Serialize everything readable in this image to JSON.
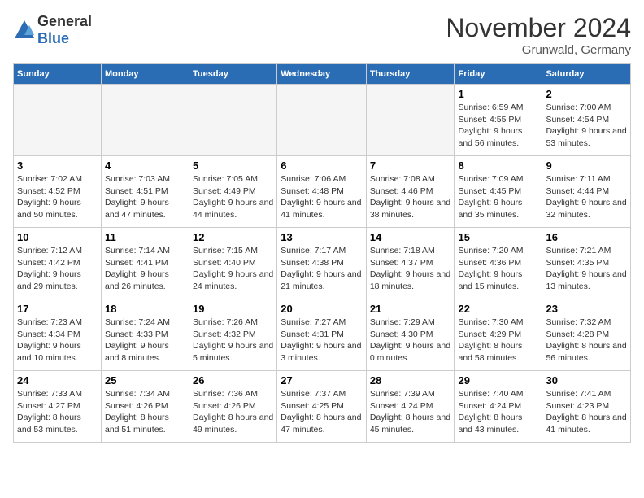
{
  "header": {
    "logo_general": "General",
    "logo_blue": "Blue",
    "month_title": "November 2024",
    "location": "Grunwald, Germany"
  },
  "days_of_week": [
    "Sunday",
    "Monday",
    "Tuesday",
    "Wednesday",
    "Thursday",
    "Friday",
    "Saturday"
  ],
  "weeks": [
    [
      {
        "day": "",
        "info": ""
      },
      {
        "day": "",
        "info": ""
      },
      {
        "day": "",
        "info": ""
      },
      {
        "day": "",
        "info": ""
      },
      {
        "day": "",
        "info": ""
      },
      {
        "day": "1",
        "info": "Sunrise: 6:59 AM\nSunset: 4:55 PM\nDaylight: 9 hours and 56 minutes."
      },
      {
        "day": "2",
        "info": "Sunrise: 7:00 AM\nSunset: 4:54 PM\nDaylight: 9 hours and 53 minutes."
      }
    ],
    [
      {
        "day": "3",
        "info": "Sunrise: 7:02 AM\nSunset: 4:52 PM\nDaylight: 9 hours and 50 minutes."
      },
      {
        "day": "4",
        "info": "Sunrise: 7:03 AM\nSunset: 4:51 PM\nDaylight: 9 hours and 47 minutes."
      },
      {
        "day": "5",
        "info": "Sunrise: 7:05 AM\nSunset: 4:49 PM\nDaylight: 9 hours and 44 minutes."
      },
      {
        "day": "6",
        "info": "Sunrise: 7:06 AM\nSunset: 4:48 PM\nDaylight: 9 hours and 41 minutes."
      },
      {
        "day": "7",
        "info": "Sunrise: 7:08 AM\nSunset: 4:46 PM\nDaylight: 9 hours and 38 minutes."
      },
      {
        "day": "8",
        "info": "Sunrise: 7:09 AM\nSunset: 4:45 PM\nDaylight: 9 hours and 35 minutes."
      },
      {
        "day": "9",
        "info": "Sunrise: 7:11 AM\nSunset: 4:44 PM\nDaylight: 9 hours and 32 minutes."
      }
    ],
    [
      {
        "day": "10",
        "info": "Sunrise: 7:12 AM\nSunset: 4:42 PM\nDaylight: 9 hours and 29 minutes."
      },
      {
        "day": "11",
        "info": "Sunrise: 7:14 AM\nSunset: 4:41 PM\nDaylight: 9 hours and 26 minutes."
      },
      {
        "day": "12",
        "info": "Sunrise: 7:15 AM\nSunset: 4:40 PM\nDaylight: 9 hours and 24 minutes."
      },
      {
        "day": "13",
        "info": "Sunrise: 7:17 AM\nSunset: 4:38 PM\nDaylight: 9 hours and 21 minutes."
      },
      {
        "day": "14",
        "info": "Sunrise: 7:18 AM\nSunset: 4:37 PM\nDaylight: 9 hours and 18 minutes."
      },
      {
        "day": "15",
        "info": "Sunrise: 7:20 AM\nSunset: 4:36 PM\nDaylight: 9 hours and 15 minutes."
      },
      {
        "day": "16",
        "info": "Sunrise: 7:21 AM\nSunset: 4:35 PM\nDaylight: 9 hours and 13 minutes."
      }
    ],
    [
      {
        "day": "17",
        "info": "Sunrise: 7:23 AM\nSunset: 4:34 PM\nDaylight: 9 hours and 10 minutes."
      },
      {
        "day": "18",
        "info": "Sunrise: 7:24 AM\nSunset: 4:33 PM\nDaylight: 9 hours and 8 minutes."
      },
      {
        "day": "19",
        "info": "Sunrise: 7:26 AM\nSunset: 4:32 PM\nDaylight: 9 hours and 5 minutes."
      },
      {
        "day": "20",
        "info": "Sunrise: 7:27 AM\nSunset: 4:31 PM\nDaylight: 9 hours and 3 minutes."
      },
      {
        "day": "21",
        "info": "Sunrise: 7:29 AM\nSunset: 4:30 PM\nDaylight: 9 hours and 0 minutes."
      },
      {
        "day": "22",
        "info": "Sunrise: 7:30 AM\nSunset: 4:29 PM\nDaylight: 8 hours and 58 minutes."
      },
      {
        "day": "23",
        "info": "Sunrise: 7:32 AM\nSunset: 4:28 PM\nDaylight: 8 hours and 56 minutes."
      }
    ],
    [
      {
        "day": "24",
        "info": "Sunrise: 7:33 AM\nSunset: 4:27 PM\nDaylight: 8 hours and 53 minutes."
      },
      {
        "day": "25",
        "info": "Sunrise: 7:34 AM\nSunset: 4:26 PM\nDaylight: 8 hours and 51 minutes."
      },
      {
        "day": "26",
        "info": "Sunrise: 7:36 AM\nSunset: 4:26 PM\nDaylight: 8 hours and 49 minutes."
      },
      {
        "day": "27",
        "info": "Sunrise: 7:37 AM\nSunset: 4:25 PM\nDaylight: 8 hours and 47 minutes."
      },
      {
        "day": "28",
        "info": "Sunrise: 7:39 AM\nSunset: 4:24 PM\nDaylight: 8 hours and 45 minutes."
      },
      {
        "day": "29",
        "info": "Sunrise: 7:40 AM\nSunset: 4:24 PM\nDaylight: 8 hours and 43 minutes."
      },
      {
        "day": "30",
        "info": "Sunrise: 7:41 AM\nSunset: 4:23 PM\nDaylight: 8 hours and 41 minutes."
      }
    ]
  ]
}
